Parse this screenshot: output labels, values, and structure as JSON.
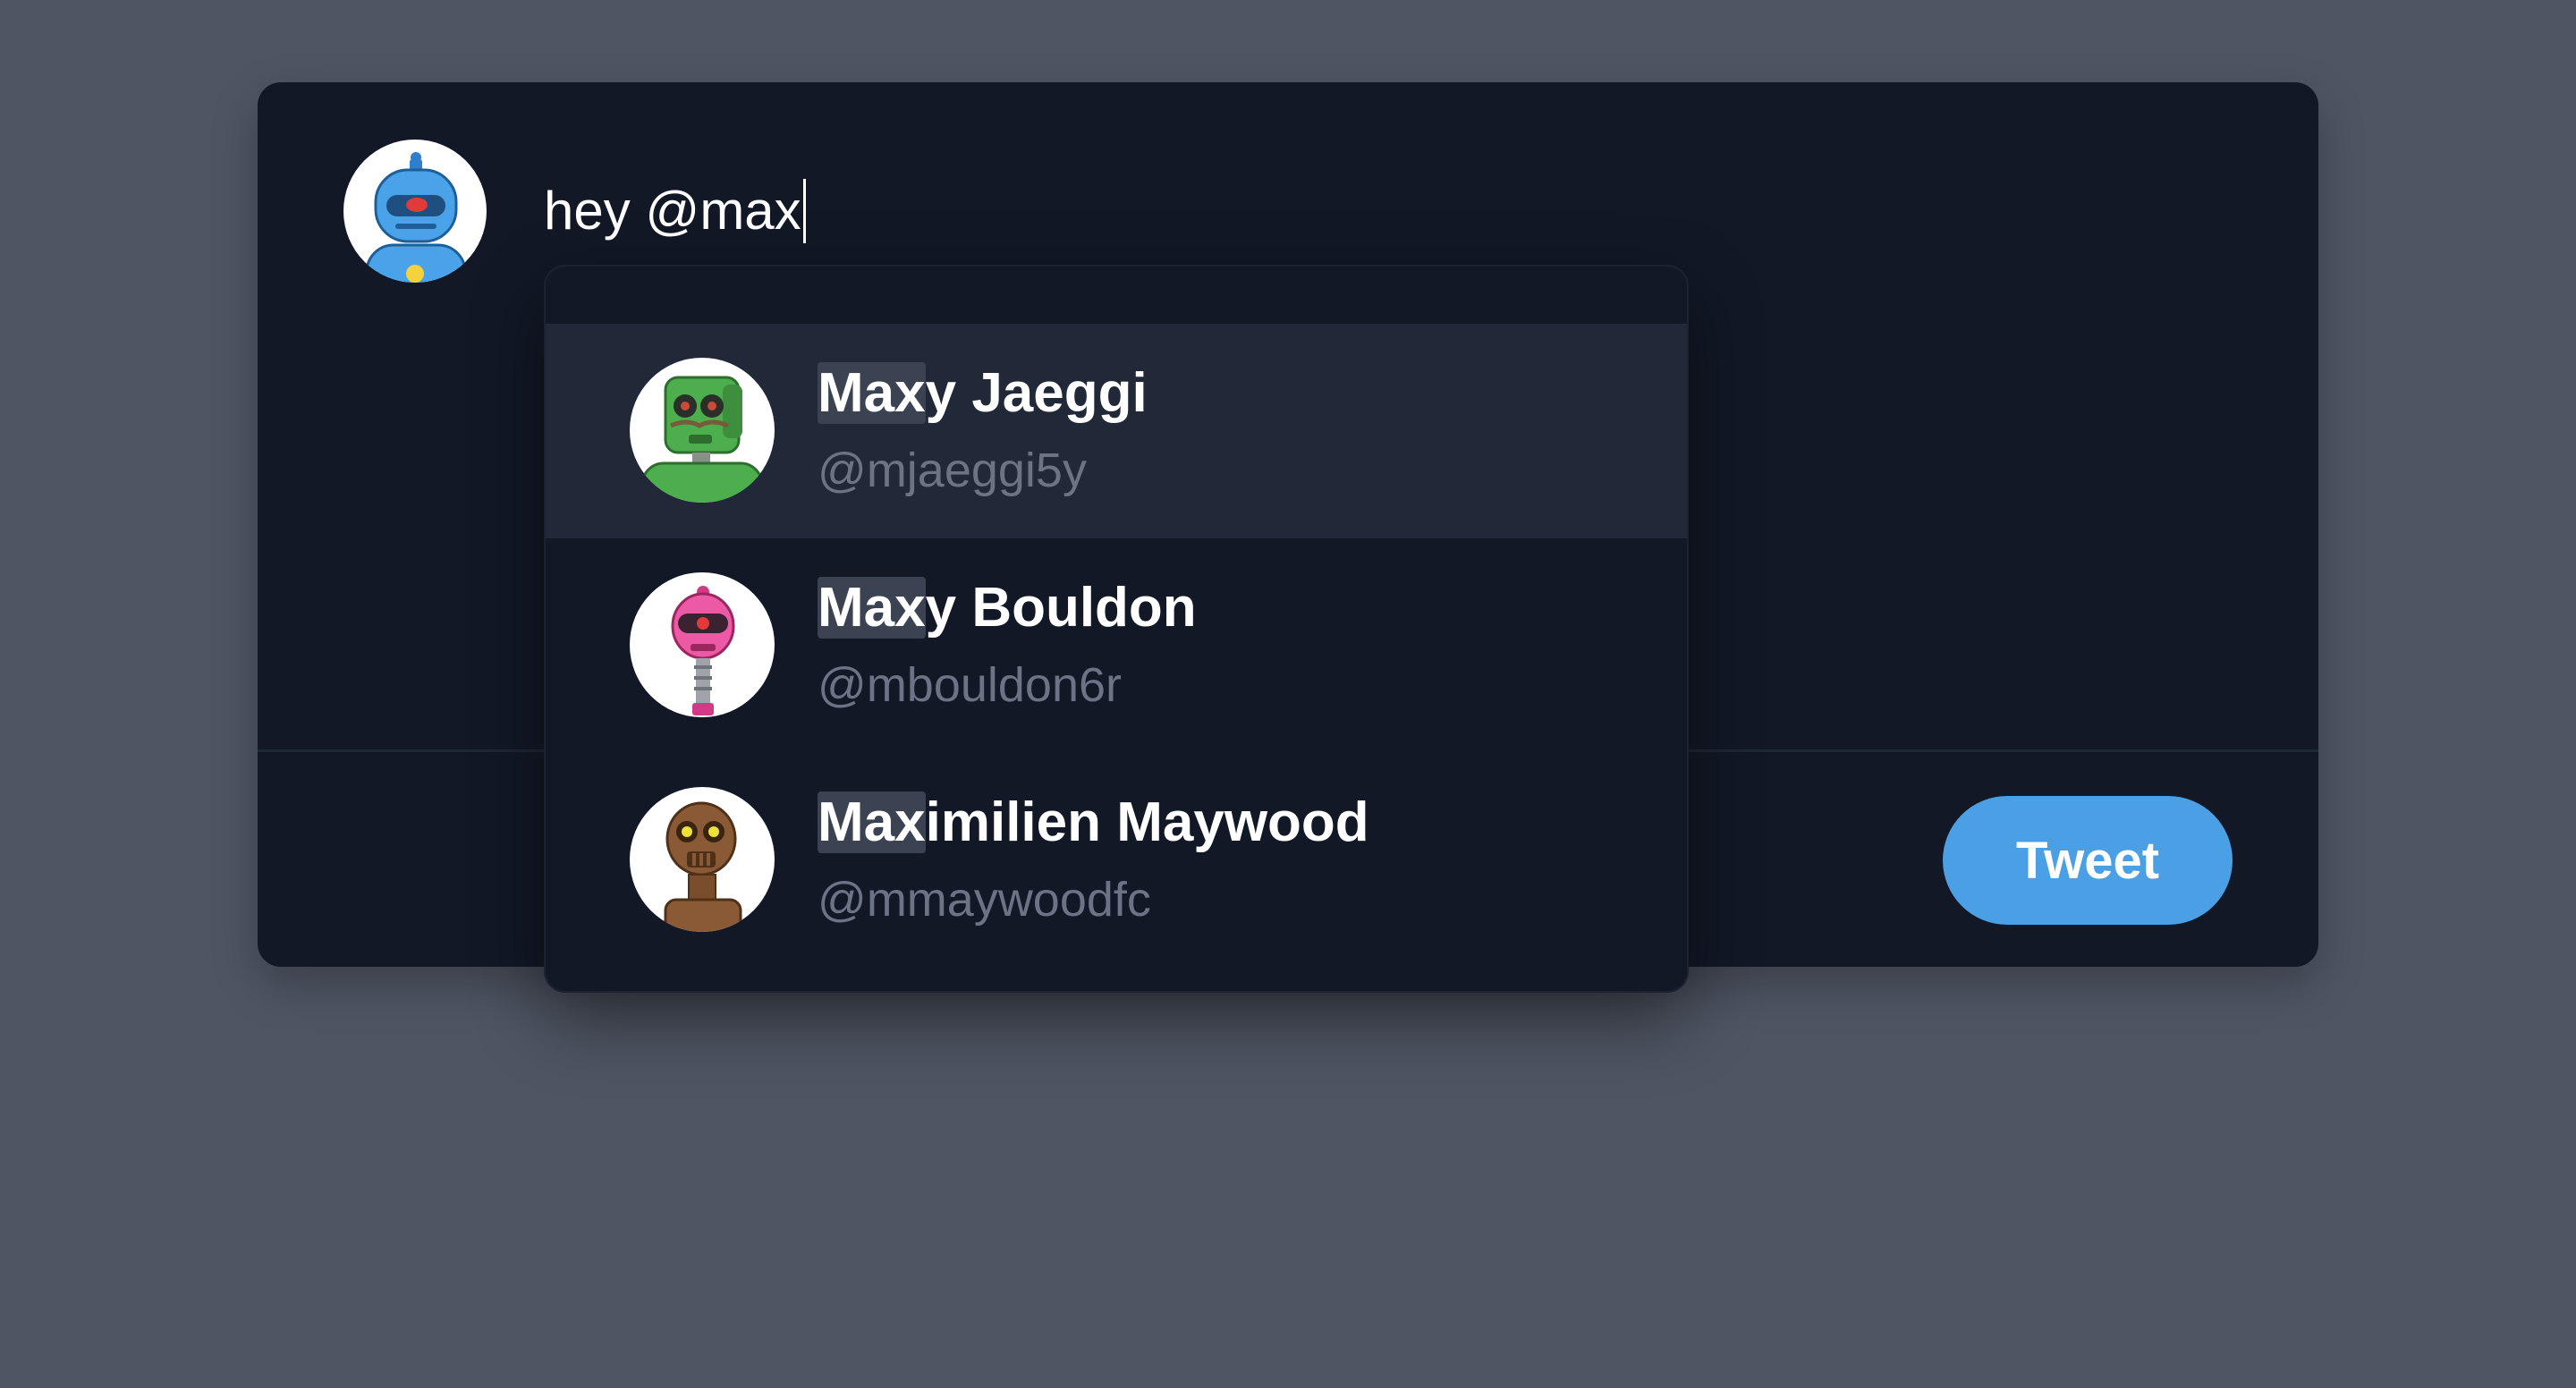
{
  "composer": {
    "text": "hey @max",
    "avatar_icon": "blue-robot-avatar"
  },
  "suggestions": [
    {
      "match": "Max",
      "rest": "y Jaeggi",
      "handle": "@mjaeggi5y",
      "avatar_icon": "green-robot-avatar",
      "active": true
    },
    {
      "match": "Max",
      "rest": "y Bouldon",
      "handle": "@mbouldon6r",
      "avatar_icon": "pink-robot-avatar",
      "active": false
    },
    {
      "match": "Max",
      "rest": "imilien Maywood",
      "handle": "@mmaywoodfc",
      "avatar_icon": "brown-robot-avatar",
      "active": false
    }
  ],
  "actions": {
    "tweet_label": "Tweet"
  },
  "colors": {
    "background": "#4f5563",
    "card": "#121826",
    "active_row": "#212837",
    "accent": "#4a9fe5",
    "match_highlight": "#3b4252"
  }
}
